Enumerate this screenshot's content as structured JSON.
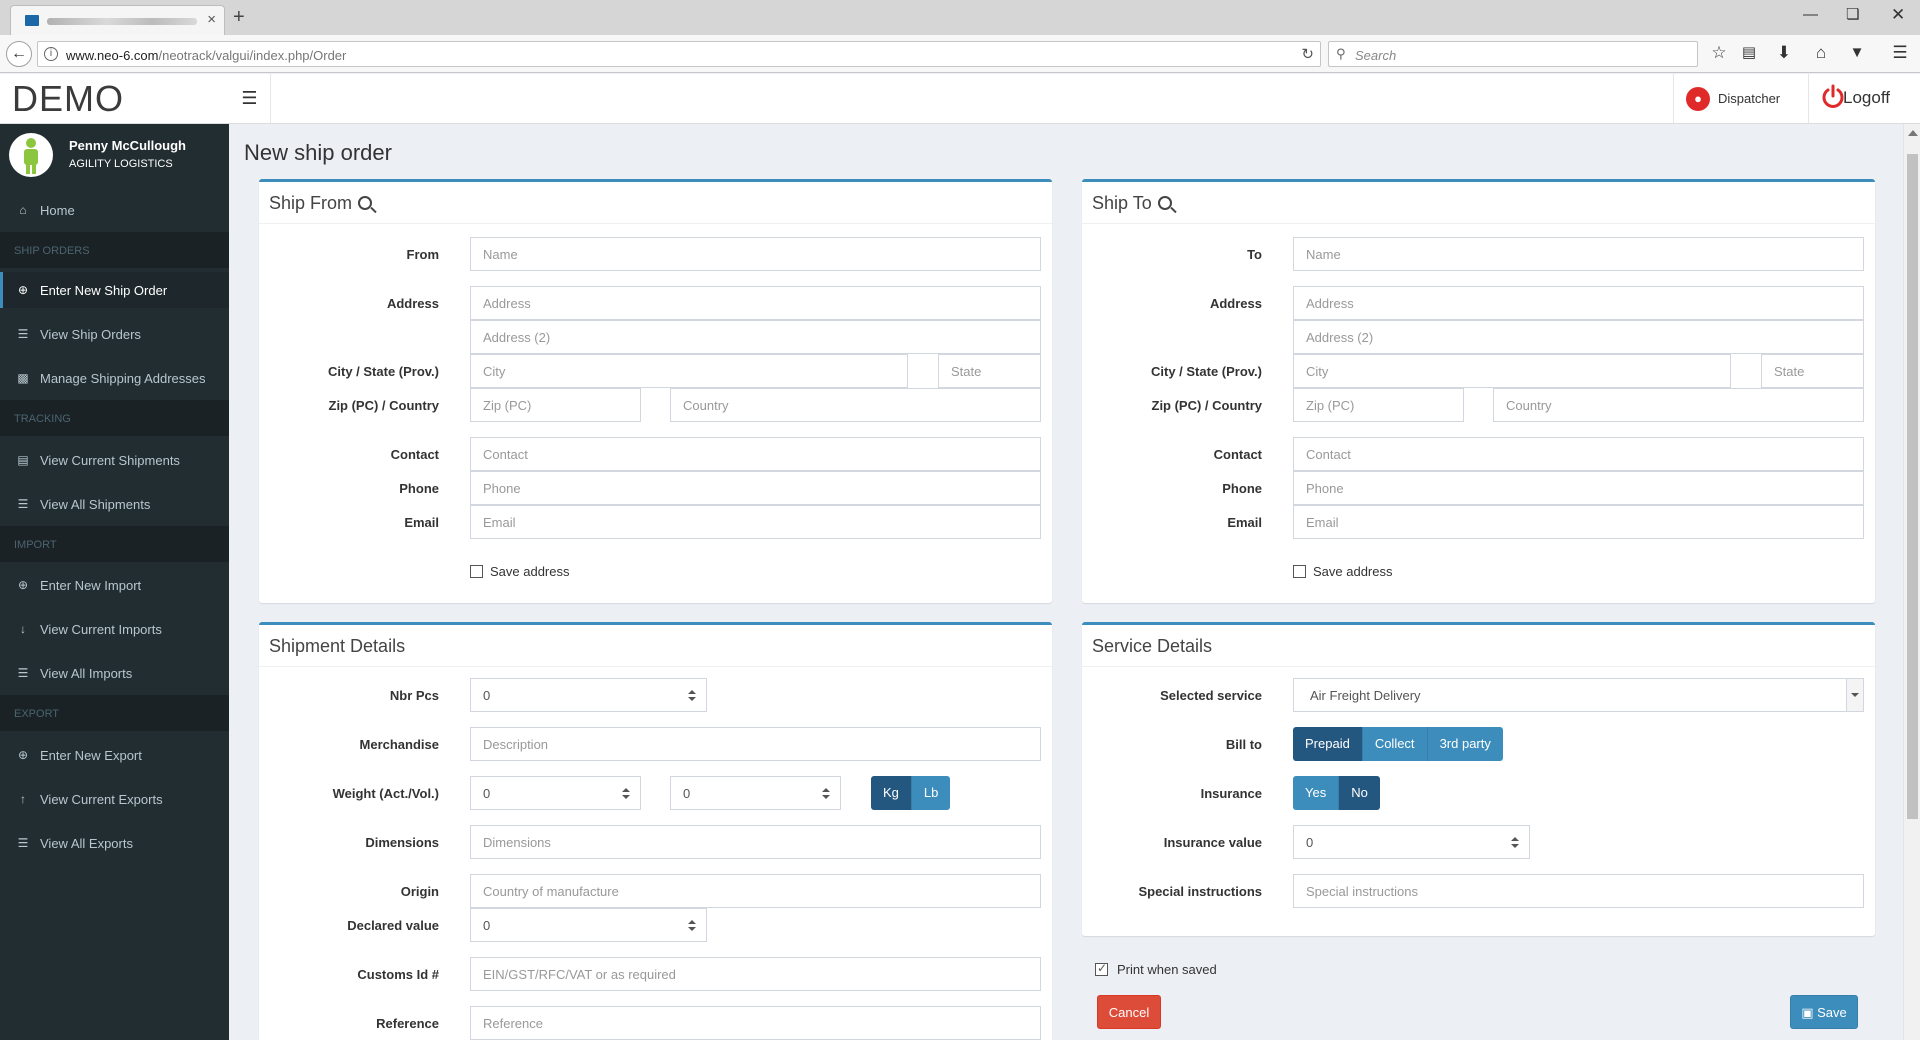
{
  "browser": {
    "tab_close": "×",
    "new_tab": "+",
    "url_host": "www.neo-6.com",
    "url_path": "/neotrack/valgui/index.php/Order",
    "search_placeholder": "Search"
  },
  "header": {
    "logo": "DEMO",
    "dispatcher_label": "Dispatcher",
    "logoff_label": "Logoff"
  },
  "user": {
    "name": "Penny McCullough",
    "company": "AGILITY LOGISTICS"
  },
  "sidebar": {
    "home": "Home",
    "ship_orders_header": "SHIP ORDERS",
    "enter_new_ship_order": "Enter New Ship Order",
    "view_ship_orders": "View Ship Orders",
    "manage_shipping_addresses": "Manage Shipping Addresses",
    "tracking_header": "TRACKING",
    "view_current_shipments": "View Current Shipments",
    "view_all_shipments": "View All Shipments",
    "import_header": "IMPORT",
    "enter_new_import": "Enter New Import",
    "view_current_imports": "View Current Imports",
    "view_all_imports": "View All Imports",
    "export_header": "EXPORT",
    "enter_new_export": "Enter New Export",
    "view_current_exports": "View Current Exports",
    "view_all_exports": "View All Exports"
  },
  "page": {
    "title": "New ship order"
  },
  "ship_from": {
    "title": "Ship From",
    "from_label": "From",
    "address_label": "Address",
    "city_state_label": "City / State (Prov.)",
    "zip_country_label": "Zip (PC) / Country",
    "contact_label": "Contact",
    "phone_label": "Phone",
    "email_label": "Email",
    "name_ph": "Name",
    "address_ph": "Address",
    "address2_ph": "Address (2)",
    "city_ph": "City",
    "state_ph": "State",
    "zip_ph": "Zip (PC)",
    "country_ph": "Country",
    "contact_ph": "Contact",
    "phone_ph": "Phone",
    "email_ph": "Email",
    "save_address": "Save address"
  },
  "ship_to": {
    "title": "Ship To",
    "to_label": "To",
    "address_label": "Address",
    "city_state_label": "City / State (Prov.)",
    "zip_country_label": "Zip (PC) / Country",
    "contact_label": "Contact",
    "phone_label": "Phone",
    "email_label": "Email",
    "name_ph": "Name",
    "address_ph": "Address",
    "address2_ph": "Address (2)",
    "city_ph": "City",
    "state_ph": "State",
    "zip_ph": "Zip (PC)",
    "country_ph": "Country",
    "contact_ph": "Contact",
    "phone_ph": "Phone",
    "email_ph": "Email",
    "save_address": "Save address"
  },
  "shipment": {
    "title": "Shipment Details",
    "nbr_pcs_label": "Nbr Pcs",
    "nbr_pcs_value": "0",
    "merchandise_label": "Merchandise",
    "merchandise_ph": "Description",
    "weight_label": "Weight (Act./Vol.)",
    "weight_act": "0",
    "weight_vol": "0",
    "unit_kg": "Kg",
    "unit_lb": "Lb",
    "dimensions_label": "Dimensions",
    "dimensions_ph": "Dimensions",
    "origin_label": "Origin",
    "origin_ph": "Country of manufacture",
    "declared_label": "Declared value",
    "declared_value": "0",
    "customs_label": "Customs Id #",
    "customs_ph": "EIN/GST/RFC/VAT or as required",
    "reference_label": "Reference",
    "reference_ph": "Reference"
  },
  "service": {
    "title": "Service Details",
    "selected_service_label": "Selected service",
    "selected_service_value": "Air Freight Delivery",
    "bill_to_label": "Bill to",
    "bill_prepaid": "Prepaid",
    "bill_collect": "Collect",
    "bill_3rd": "3rd party",
    "insurance_label": "Insurance",
    "ins_yes": "Yes",
    "ins_no": "No",
    "insurance_value_label": "Insurance value",
    "insurance_value": "0",
    "special_label": "Special instructions",
    "special_ph": "Special instructions"
  },
  "footer": {
    "print_when_saved": "Print when saved",
    "cancel": "Cancel",
    "save": "Save"
  }
}
